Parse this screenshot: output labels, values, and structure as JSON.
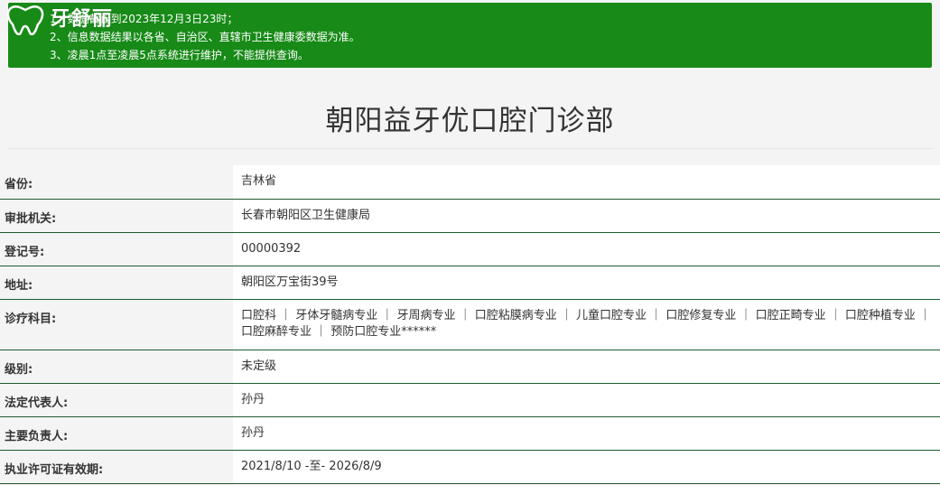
{
  "brand": {
    "logo_text": "牙舒丽"
  },
  "notice": {
    "lines": [
      "1、数据截止到2023年12月3日23时；",
      "2、信息数据结果以各省、自治区、直辖市卫生健康委数据为准。",
      "3、凌晨1点至凌晨5点系统进行维护，不能提供查询。"
    ]
  },
  "page_title": "朝阳益牙优口腔门诊部",
  "rows": [
    {
      "label": "省份:",
      "value": "吉林省"
    },
    {
      "label": "审批机关:",
      "value": "长春市朝阳区卫生健康局"
    },
    {
      "label": "登记号:",
      "value": "00000392"
    },
    {
      "label": "地址:",
      "value": "朝阳区万宝街39号"
    },
    {
      "label": "诊疗科目:",
      "value": "口腔科 ｜ 牙体牙髓病专业 ｜ 牙周病专业 ｜ 口腔粘膜病专业 ｜ 儿童口腔专业 ｜ 口腔修复专业 ｜ 口腔正畸专业 ｜ 口腔种植专业 ｜ 口腔麻醉专业 ｜ 预防口腔专业******"
    },
    {
      "label": "级别:",
      "value": "未定级"
    },
    {
      "label": "法定代表人:",
      "value": "孙丹"
    },
    {
      "label": "主要负责人:",
      "value": "孙丹"
    },
    {
      "label": "执业许可证有效期:",
      "value": "2021/8/10 -至- 2026/8/9"
    }
  ]
}
